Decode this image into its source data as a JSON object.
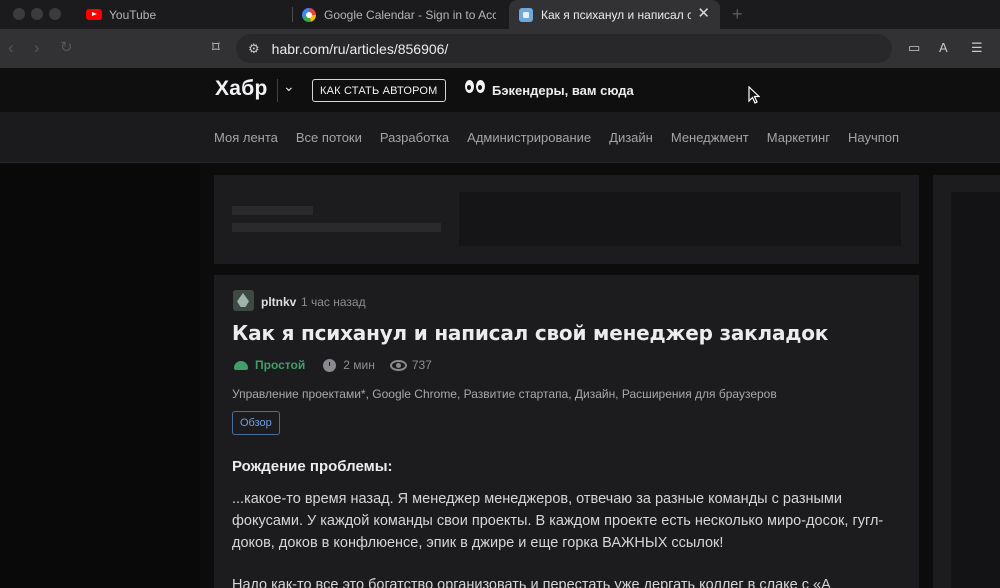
{
  "browser": {
    "tabs": [
      {
        "title": "YouTube",
        "icon": "youtube-icon",
        "active": false
      },
      {
        "title": "Google Calendar - Sign in to Acce",
        "icon": "google-icon",
        "active": false
      },
      {
        "title": "Как я психанул и написал св",
        "icon": "habr-favicon-icon",
        "active": true
      }
    ],
    "url": "habr.com/ru/articles/856906/"
  },
  "habr": {
    "logo": "Хабр",
    "author_button": "КАК СТАТЬ АВТОРОМ",
    "promo": "Бэкендеры, вам сюда",
    "nav": [
      "Моя лента",
      "Все потоки",
      "Разработка",
      "Администрирование",
      "Дизайн",
      "Менеджмент",
      "Маркетинг",
      "Научпоп"
    ]
  },
  "article": {
    "author": "pltnkv",
    "time": "1 час назад",
    "title": "Как я психанул и написал свой менеджер закладок",
    "difficulty": "Простой",
    "read_time": "2 мин",
    "views": "737",
    "hubs": "Управление проектами*, Google Chrome, Развитие стартапа, Дизайн, Расширения для браузеров",
    "tag": "Обзор",
    "section_heading": "Рождение проблемы:",
    "paragraph1": "...какое-то время назад. Я менеджер менеджеров, отвечаю за разные команды с разными фокусами. У каждой команды свои проекты. В каждом проекте есть несколько миро-досок, гугл-доков, доков в конфлюенсе, эпик в джире и еще горка ВАЖНЫХ ссылок!",
    "paragraph2": "Надо как-то все это богатство организовать и перестать уже дергать коллег в слаке с «А"
  },
  "colors": {
    "accent_green": "#3f9e6a",
    "tag_blue": "#6f9fe0",
    "background": "#0c0c0d",
    "card": "#1c1c1e"
  }
}
